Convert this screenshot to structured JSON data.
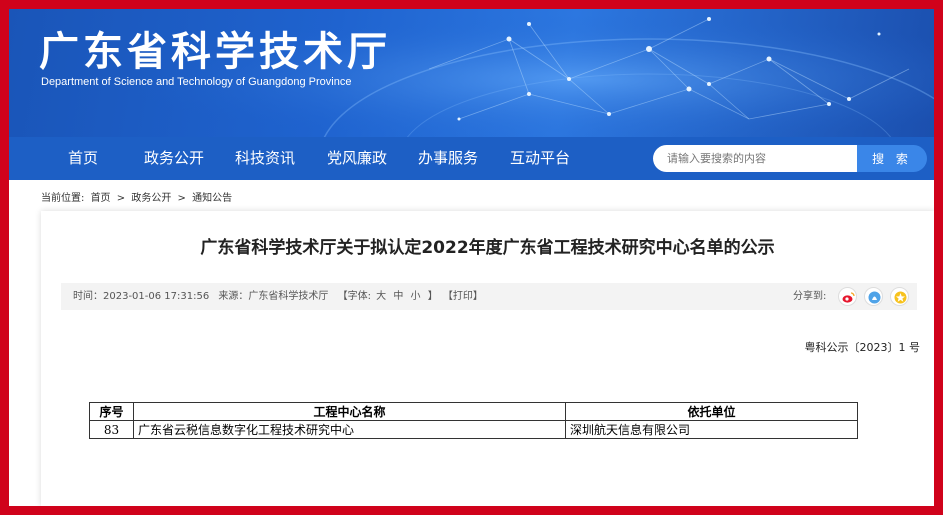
{
  "banner": {
    "title": "广东省科学技术厅",
    "subtitle": "Department of Science and Technology of Guangdong Province"
  },
  "nav": {
    "items": [
      "首页",
      "政务公开",
      "科技资讯",
      "党风廉政",
      "办事服务",
      "互动平台"
    ]
  },
  "search": {
    "placeholder": "请输入要搜索的内容",
    "button_label": "搜 索"
  },
  "breadcrumb": {
    "label": "当前位置:",
    "items": [
      "首页",
      "政务公开",
      "通知公告"
    ],
    "separator": ">"
  },
  "article": {
    "title": "广东省科学技术厅关于拟认定2022年度广东省工程技术研究中心名单的公示",
    "time": "时间：2023-01-06 17:31:56",
    "source": "来源：广东省科学技术厅",
    "font_label": "【字体:",
    "font_large": "大",
    "font_medium": "中",
    "font_small": "小",
    "font_close": "】",
    "print": "【打印】",
    "share_label": "分享到:",
    "doc_number": "粤科公示〔2023〕1 号"
  },
  "table": {
    "headers": [
      "序号",
      "工程中心名称",
      "依托单位"
    ],
    "rows": [
      [
        "83",
        "广东省云税信息数字化工程技术研究中心",
        "深圳航天信息有限公司"
      ]
    ]
  },
  "share_icons": [
    "weibo-icon",
    "qq-icon",
    "qzone-icon"
  ],
  "colors": {
    "frame": "#d0021b",
    "nav_bg": "#1d5fc5",
    "search_btn": "#3a86e8"
  }
}
